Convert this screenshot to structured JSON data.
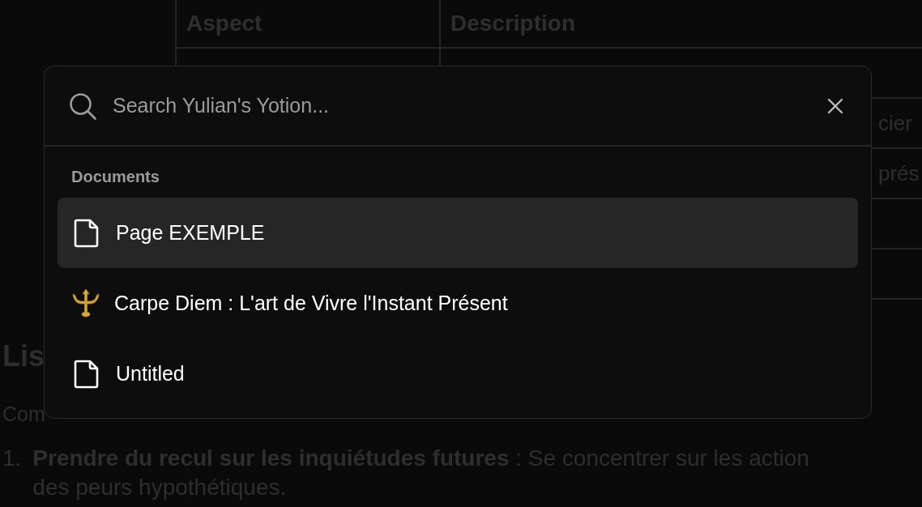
{
  "page": {
    "table": {
      "columns": [
        "Aspect",
        "Description"
      ],
      "rows": [
        {
          "column_2": ""
        },
        {
          "column_2": "cier"
        },
        {
          "column_2": "prés"
        },
        {
          "column_2": ""
        },
        {
          "column_2": ""
        }
      ]
    },
    "heading": "Lis",
    "intro": "Com",
    "list": [
      {
        "marker": "1.",
        "text": "**Prendre du recul sur les inquiétudes futures** : Se concentrer sur les action",
        "continuation": "des peurs hypothétiques."
      }
    ]
  },
  "search_dialog": {
    "search": {
      "placeholder": "Search Yulian's Yotion..."
    },
    "section": "Documents",
    "results": [
      {
        "kind": "file",
        "title": "Page EXEMPLE",
        "selected": true
      },
      {
        "kind": "trident",
        "title": "Carpe Diem : L'art de Vivre l'Instant Présent",
        "selected": false
      },
      {
        "kind": "file",
        "title": "Untitled",
        "selected": false
      }
    ]
  }
}
